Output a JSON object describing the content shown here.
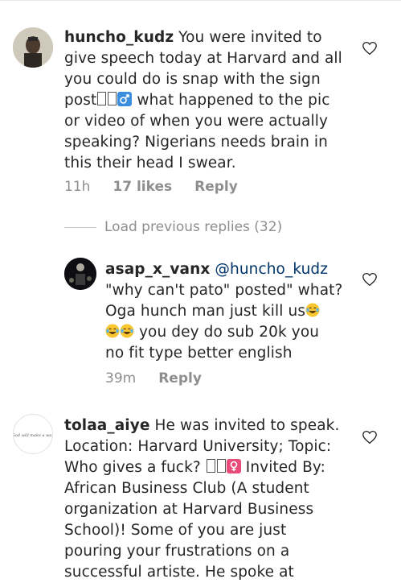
{
  "comments": [
    {
      "username": "huncho_kudz",
      "text_lines": [
        " You were invited to",
        "give speech today at Harvard and all",
        "you could do is snap with the sign",
        "post",
        " what happened to the pic",
        "or video of when you were actually",
        "speaking? Nigerians needs brain in",
        "this their head I swear."
      ],
      "time": "11h",
      "likes": "17 likes",
      "reply": "Reply"
    },
    {
      "username": "asap_x_vanx",
      "mention": "@huncho_kudz",
      "text_lines": [
        "\"why can't pato\" posted\" what?",
        "Oga hunch man just kill us",
        " you dey do sub 20k you",
        "no fit type better english"
      ],
      "time": "39m",
      "reply": "Reply"
    },
    {
      "username": "tolaa_aiye",
      "text_lines": [
        " He was invited to speak.",
        "Location: Harvard University; Topic:",
        "Who gives a fuck? ",
        " Invited By:",
        "African Business Club (A student",
        "organization at Harvard Business",
        "School)! Some of you are just",
        "pouring your frustrations on a",
        "successful artiste. He spoke at"
      ],
      "avatar_script": "God will make a way"
    }
  ],
  "load_previous": "Load previous replies (32)",
  "icons": {
    "like": "heart-outline-icon",
    "male_sign": "male-sign-icon",
    "female_sign": "female-sign-icon",
    "laugh": "tears-of-joy-emoji"
  }
}
